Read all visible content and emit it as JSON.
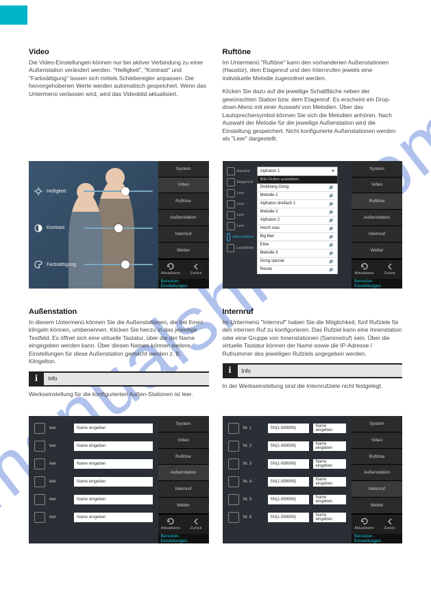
{
  "watermark": "manualshive.com",
  "sidebar": {
    "tabs": [
      "System",
      "Video",
      "Ruftöne",
      "Außenstation",
      "Internruf",
      "Wetter"
    ],
    "refresh": "Aktualisiere",
    "back": "Zurück",
    "banner": "Benutzer-Einstellungen"
  },
  "sections": {
    "video": {
      "title": "Video",
      "text1": "Die Video-Einstellungen können nur bei aktiver Verbindung zu einer Außenstation verändert werden. \"Helligkeit\", \"Kontrast\" und \"Farbsättigung\" lassen sich mittels Schieberegler anpassen. Die hervorgehobenen Werte werden automatisch gespeichert. Wenn das Untermenü verlassen wird, wird das Videobild aktualisiert.",
      "controls": [
        {
          "label": "Helligkeit",
          "pos": 0.55
        },
        {
          "label": "Kontrast",
          "pos": 0.45
        },
        {
          "label": "Farbsättigung",
          "pos": 0.55
        }
      ]
    },
    "ruftone": {
      "title": "Ruftöne",
      "text1": "Im Untermenü \"Ruftöne\" kann den vorhandenen Außenstationen (Haustür), dem Etagenruf und den Internrufen jeweils eine individuelle Melodie zugeordnet werden.",
      "text2": "Klicken Sie dazu auf die jeweilige Schaltfläche neben der gewünschten Station bzw. dem Etagenruf. Es erscheint ein Drop-down-Menü mit einer Auswahl von Melodien. Über das Lautsprechersymbol können Sie sich die Melodien anhören. Nach Auswahl der Melodie für die jeweilige Außenstation wird die Einstellung gespeichert. Nicht konfigurierte Außenstationen werden als \"Leer\" dargestellt.",
      "icons": [
        "Haustür",
        "Etagenruf",
        "Leer",
        "Leer",
        "Leer",
        "Leer",
        "Internruftöne",
        "Lautstärke"
      ],
      "selected": "Alphaton 1",
      "dropdown_header": "Bitte Rufton auswählen",
      "options": [
        "Dreiklang Gong",
        "Melodie 1",
        "Alphaton dreifach 1",
        "Melodie 2",
        "Alphaton 2",
        "Horch was",
        "Big Ben",
        "Elise",
        "Melodie 3",
        "Gong spezial",
        "Rondo"
      ]
    },
    "aussen": {
      "title": "Außenstation",
      "text1": "In diesem Untermenü können Sie die Außenstationen, die bei Ihnen klingeln können, umbenennen. Klicken Sie hierzu in das jeweilige Textfeld. Es öffnet sich eine virtuelle Tastatur, über die der Name eingegeben werden kann. Über diesen Namen können weitere Einstellungen für diese Außenstation gemacht werden z. B. Klingelton.",
      "info": "Info",
      "info_text": "Werkseinstellung für die konfigurierten Außen-Stationen ist leer.",
      "rows": [
        {
          "label": "leer",
          "placeholder": "Name eingeben"
        },
        {
          "label": "leer",
          "placeholder": "Name eingeben"
        },
        {
          "label": "leer",
          "placeholder": "Name eingeben"
        },
        {
          "label": "leer",
          "placeholder": "Name eingeben"
        },
        {
          "label": "leer",
          "placeholder": "Name eingeben"
        },
        {
          "label": "leer",
          "placeholder": "Name eingeben"
        }
      ]
    },
    "intern": {
      "title": "Internruf",
      "text1": "Im Untermenü \"Internruf\" haben Sie die Möglichkeit, fünf Rufziele für den internen Ruf zu konfigurieren. Das Rufziel kann eine Innenstation oder eine Gruppe von Innenstationen (Sammelruf) sein. Über die virtuelle Tastatur können der Name sowie die IP-Adresse / Rufnummer des jeweiligen Rufziels angegeben werden.",
      "info": "Info",
      "info_text": "In der Werkseinstellung sind die Internrufziele nicht festgelegt.",
      "rows": [
        {
          "no": "Nr. 1",
          "sn": "SN(1-999999)",
          "name": "Name eingeben"
        },
        {
          "no": "Nr. 2",
          "sn": "SN(1-999999)",
          "name": "Name eingeben"
        },
        {
          "no": "Nr. 3",
          "sn": "SN(1-999999)",
          "name": "Name eingeben"
        },
        {
          "no": "Nr. 4",
          "sn": "SN(1-999999)",
          "name": "Name eingeben"
        },
        {
          "no": "Nr. 5",
          "sn": "SN(1-999999)",
          "name": "Name eingeben"
        },
        {
          "no": "Nr. 6",
          "sn": "SN(1-999999)",
          "name": "Name eingeben"
        }
      ]
    }
  }
}
